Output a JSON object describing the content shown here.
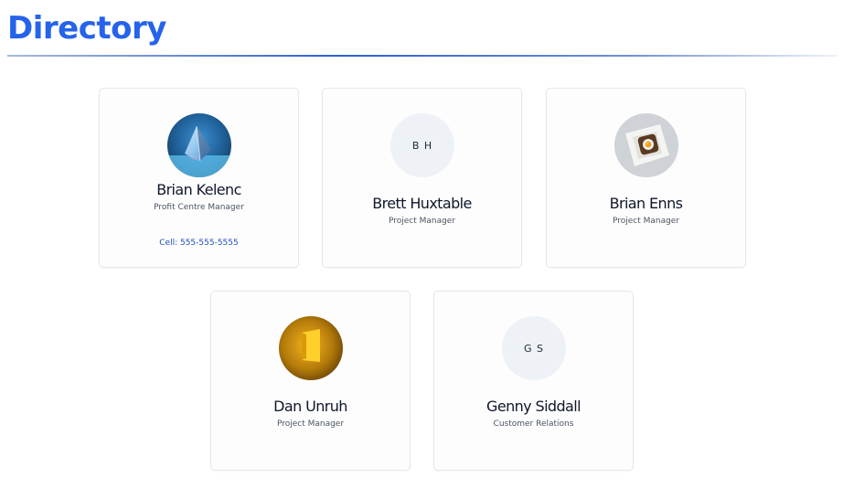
{
  "page": {
    "title": "Directory"
  },
  "people": [
    {
      "name": "Brian Kelenc",
      "role": "Profit Centre Manager",
      "cell": "Cell: 555-555-5555",
      "avatar_type": "photo",
      "avatar_subject": "prism-icon"
    },
    {
      "name": "Brett Huxtable",
      "role": "Project Manager",
      "initials": "B H",
      "avatar_type": "initials"
    },
    {
      "name": "Brian Enns",
      "role": "Project Manager",
      "avatar_type": "photo",
      "avatar_subject": "toast-on-plate-icon"
    },
    {
      "name": "Dan Unruh",
      "role": "Project Manager",
      "avatar_type": "photo",
      "avatar_subject": "yellow-doorway-icon"
    },
    {
      "name": "Genny Siddall",
      "role": "Customer Relations",
      "initials": "G S",
      "avatar_type": "initials"
    }
  ],
  "colors": {
    "accent": "#2563eb",
    "cell_link": "#1e4fc2",
    "initials_bg": "#eef1f6",
    "card_border": "#e5e7eb"
  }
}
